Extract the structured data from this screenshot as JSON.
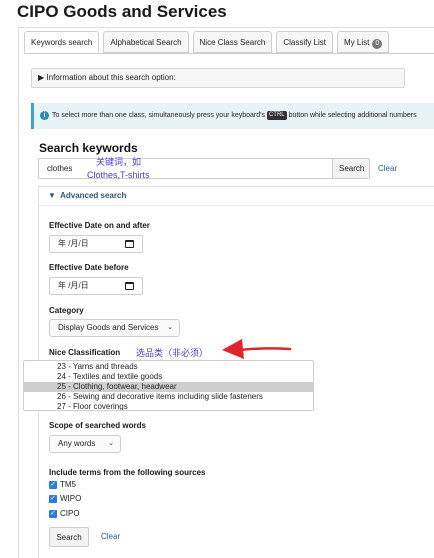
{
  "page": {
    "title": "CIPO Goods and Services"
  },
  "tabs": [
    {
      "label": "Keywords search"
    },
    {
      "label": "Alphabetical Search"
    },
    {
      "label": "Nice Class Search"
    },
    {
      "label": "Classify List"
    },
    {
      "label": "My List",
      "badge": "0"
    }
  ],
  "info_bar": {
    "label": "Information about this search option:"
  },
  "notice": {
    "text_before": "To select more than one class, simultaneously press your keyboard's",
    "key": "CTRL",
    "text_after": "button while selecting additional numbers"
  },
  "search": {
    "heading": "Search keywords",
    "value": "clothes",
    "button": "Search",
    "clear": "Clear",
    "annotation_line1": "关键词，如",
    "annotation_line2": "Clothes,T-shirts"
  },
  "advanced": {
    "header": "Advanced search",
    "effective_on_after_label": "Effective Date on and after",
    "effective_before_label": "Effective Date before",
    "date_placeholder": "年 /月/日",
    "category_label": "Category",
    "category_value": "Display Goods and Services",
    "nice_label": "Nice Classification",
    "nice_annotation": "选品类（非必须）",
    "nice_options": [
      {
        "label": "23 - Yarns and threads",
        "selected": false
      },
      {
        "label": "24 - Textiles and textile goods",
        "selected": false
      },
      {
        "label": "25 - Clothing, footwear, headwear",
        "selected": true
      },
      {
        "label": "26 - Sewing and decorative items including slide fasteners",
        "selected": false
      },
      {
        "label": "27 - Floor coverings",
        "selected": false
      }
    ],
    "scope_label": "Scope of searched words",
    "scope_value": "Any words",
    "sources_label": "Include terms from the following sources",
    "sources": [
      {
        "label": "TM5",
        "checked": true
      },
      {
        "label": "WIPO",
        "checked": true
      },
      {
        "label": "CIPO",
        "checked": true
      }
    ],
    "search_button": "Search",
    "clear": "Clear"
  },
  "colors": {
    "link": "#1f5f9e",
    "annotation": "#4a3fcf",
    "arrow": "#e0262b",
    "notice_bg": "#e8f3f8",
    "checkbox": "#2a7be4"
  }
}
